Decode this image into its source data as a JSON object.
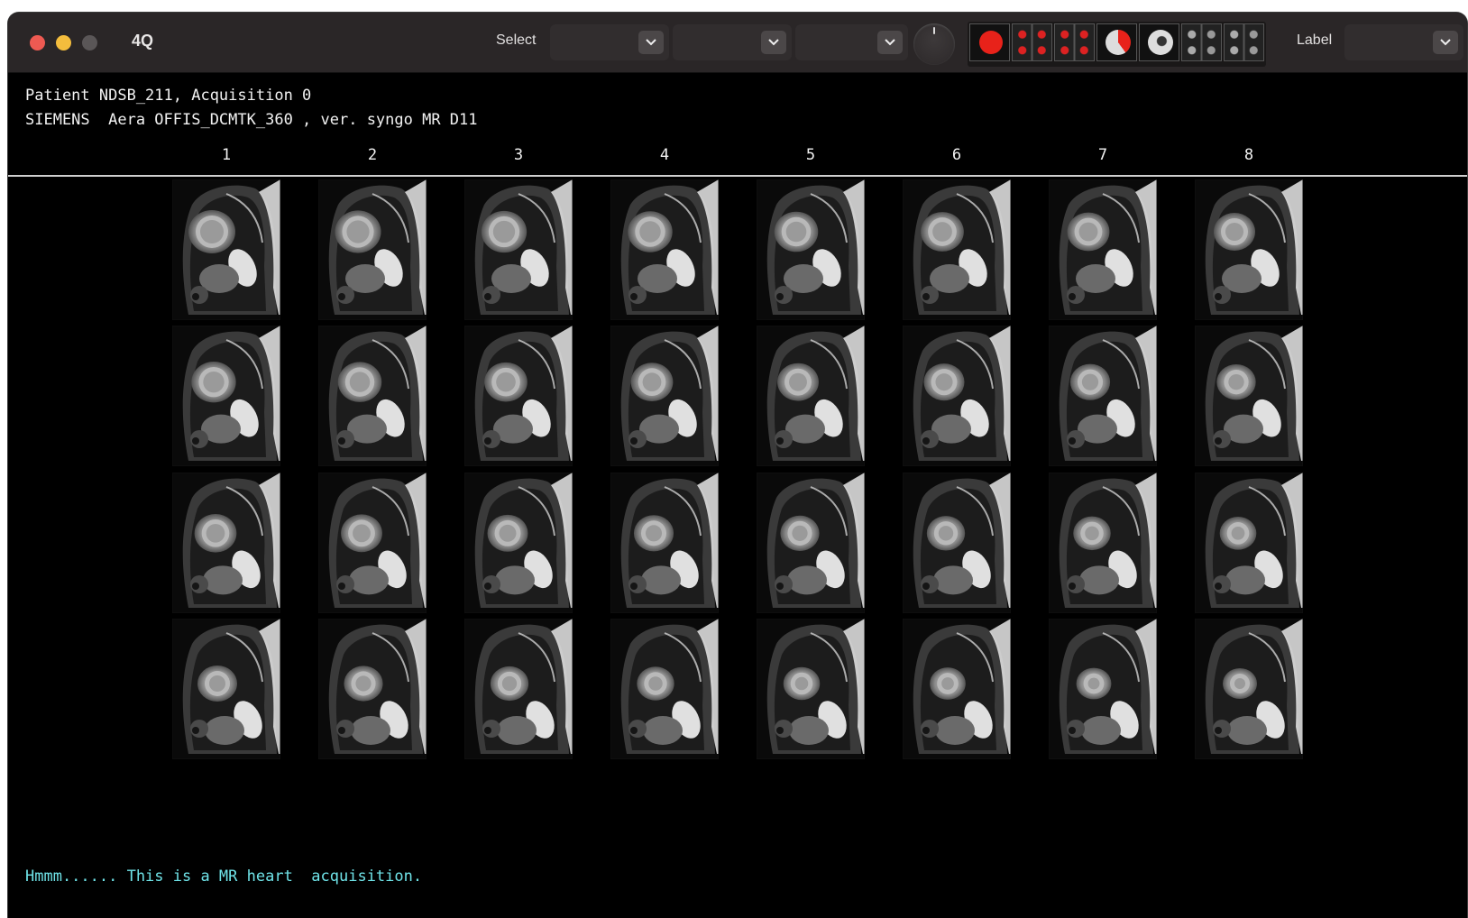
{
  "window": {
    "title": "4Q",
    "toolbar": {
      "select_label": "Select",
      "select_value_1": "",
      "select_value_2": "",
      "select_value_3": "",
      "label_label": "Label",
      "label_value": "",
      "chevron_icon": "chevron-down-icon",
      "knob_icon": "rotary-knob"
    },
    "thumbnails": [
      {
        "name": "heart-red-overlay-thumbnail"
      },
      {
        "name": "four-panel-thumbnail"
      },
      {
        "name": "four-panel-thumbnail"
      },
      {
        "name": "heart-half-red-thumbnail"
      },
      {
        "name": "heart-white-thumbnail"
      },
      {
        "name": "four-panel-bw-thumbnail"
      },
      {
        "name": "four-panel-bw-thumbnail"
      }
    ]
  },
  "viewer": {
    "header_line_1": "Patient NDSB_211, Acquisition 0",
    "header_line_2": "SIEMENS  Aera OFFIS_DCMTK_360 , ver. syngo MR D11",
    "columns": [
      "1",
      "2",
      "3",
      "4",
      "5",
      "6",
      "7",
      "8"
    ],
    "rows": 4,
    "image_kind": "MR heart short-axis slice",
    "status": "Hmmm...... This is a MR heart  acquisition.",
    "status_color": "#6fe3e8"
  }
}
